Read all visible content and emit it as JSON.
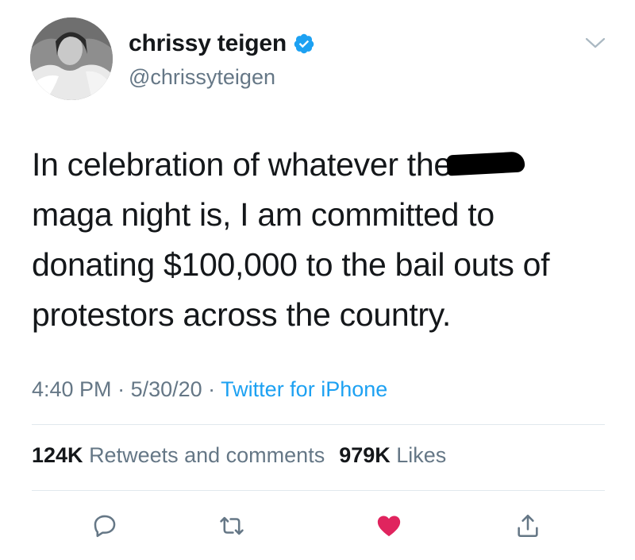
{
  "user": {
    "display_name": "chrissy teigen",
    "handle": "@chrissyteigen",
    "verified": true
  },
  "tweet": {
    "lines": [
      "In celebration of whatever the",
      "maga night is, I am committed to",
      "donating $100,000 to the bail outs of",
      "protestors across the country."
    ]
  },
  "meta": {
    "time": "4:40 PM",
    "separator1": " · ",
    "date": "5/30/20",
    "separator2": " · ",
    "source": "Twitter for iPhone"
  },
  "stats": {
    "retweets_count": "124K",
    "retweets_label": "Retweets and comments",
    "likes_count": "979K",
    "likes_label": "Likes"
  },
  "actions": {
    "liked": true,
    "like_color": "#e0245e",
    "icon_color": "#657786"
  },
  "colors": {
    "link": "#1da1f2",
    "verified": "#1da1f2",
    "secondary_text": "#657786"
  }
}
